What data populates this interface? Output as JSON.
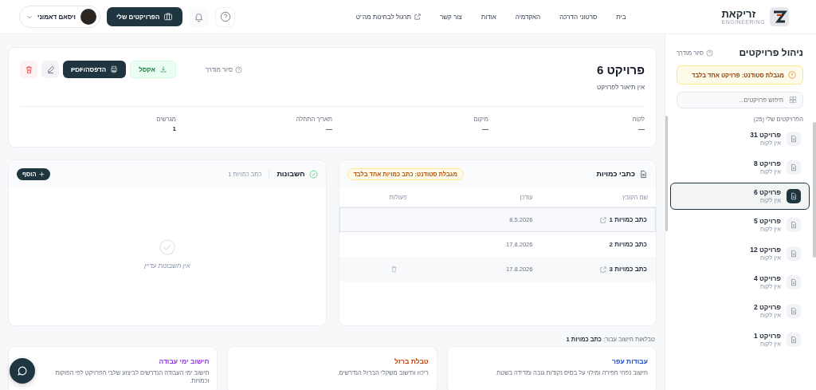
{
  "header": {
    "logo_name": "זריקאת",
    "logo_sub": "ENGINEERING",
    "nav": [
      {
        "label": "בית",
        "external": false
      },
      {
        "label": "סרטוני הדרכה",
        "external": false
      },
      {
        "label": "האקדמיה",
        "external": false
      },
      {
        "label": "אודות",
        "external": false
      },
      {
        "label": "צור קשר",
        "external": false
      },
      {
        "label": "תרגול לבחינות מה\"ט",
        "external": true
      }
    ],
    "my_projects_button": "הפרויקטים שלי",
    "user": {
      "name": "ויסאם דאמוני"
    }
  },
  "sidebar": {
    "title": "ניהול פרויקטים",
    "tour": "סיור מודרך",
    "warning": "מגבלת סטודנט: פרויקט אחד בלבד",
    "search": {
      "placeholder": "חיפוש פרויקטים..."
    },
    "list_label": "הפרויקטים שלי (25)",
    "projects": [
      {
        "name": "פרויקט 31",
        "client": "אין לקוח",
        "selected": false
      },
      {
        "name": "פרויקט 8",
        "client": "אין לקוח",
        "selected": false
      },
      {
        "name": "פרויקט 6",
        "client": "אין לקוח",
        "selected": true
      },
      {
        "name": "פרויקט 5",
        "client": "אין לקוח",
        "selected": false
      },
      {
        "name": "פרויקט 12",
        "client": "אין לקוח",
        "selected": false
      },
      {
        "name": "פרויקט 4",
        "client": "אין לקוח",
        "selected": false
      },
      {
        "name": "פרויקט 2",
        "client": "אין לקוח",
        "selected": false
      },
      {
        "name": "פרויקט 1",
        "client": "אין לקוח",
        "selected": false
      }
    ]
  },
  "project": {
    "title": "פרויקט 6",
    "description": "אין תיאור לפרויקט",
    "tour": "סיור מודרך",
    "excel_button": "אקסל",
    "print_button": "הדפסה/PDF",
    "fields": [
      {
        "label": "לקוח",
        "value": "—"
      },
      {
        "label": "מיקום",
        "value": "—"
      },
      {
        "label": "תאריך התחלה",
        "value": "—"
      },
      {
        "label": "מגרשים",
        "value": "1"
      }
    ]
  },
  "quantities": {
    "title": "כתבי כמויות",
    "badge": "מגבלת סטודנט: כתב כמויות אחד בלבד",
    "columns": [
      "שם הקובץ",
      "עודכן",
      "פעולות"
    ],
    "rows": [
      {
        "name": "כתב כמויות 1",
        "date": "8.5.2026",
        "linked": true,
        "deletable": false,
        "selected": true
      },
      {
        "name": "כתב כמויות 2",
        "date": "17.8.2026",
        "linked": false,
        "deletable": false,
        "selected": false
      },
      {
        "name": "כתב כמויות 3",
        "date": "17.8.2026",
        "linked": true,
        "deletable": true,
        "selected": false
      }
    ]
  },
  "invoices": {
    "title": "חשבונות",
    "context": "כתב כמויות 1",
    "add_button": "הוסף",
    "empty": "אין חשבונות עדיין"
  },
  "calc_tables": {
    "label": "טבלאות חישוב עבור:",
    "target": "כתב כמויות 1",
    "cards": [
      {
        "title": "עבודות עפר",
        "description": "חישוב נפחי חפירה ומילוי על בסיס נקודות גובה ומדידה בשטח.",
        "color": "#1d4ed8"
      },
      {
        "title": "טבלת ברזל",
        "description": "ריכוז וחישוב משקלי הברזל הנדרשים.",
        "color": "#c2410c"
      },
      {
        "title": "חישוב ימי עבודה",
        "description": "חישוב ימי העבודה הנדרשים לביצוע שלבי הפרויקט לפי הפוקות וכמויות.",
        "color": "#9333ea"
      }
    ]
  }
}
